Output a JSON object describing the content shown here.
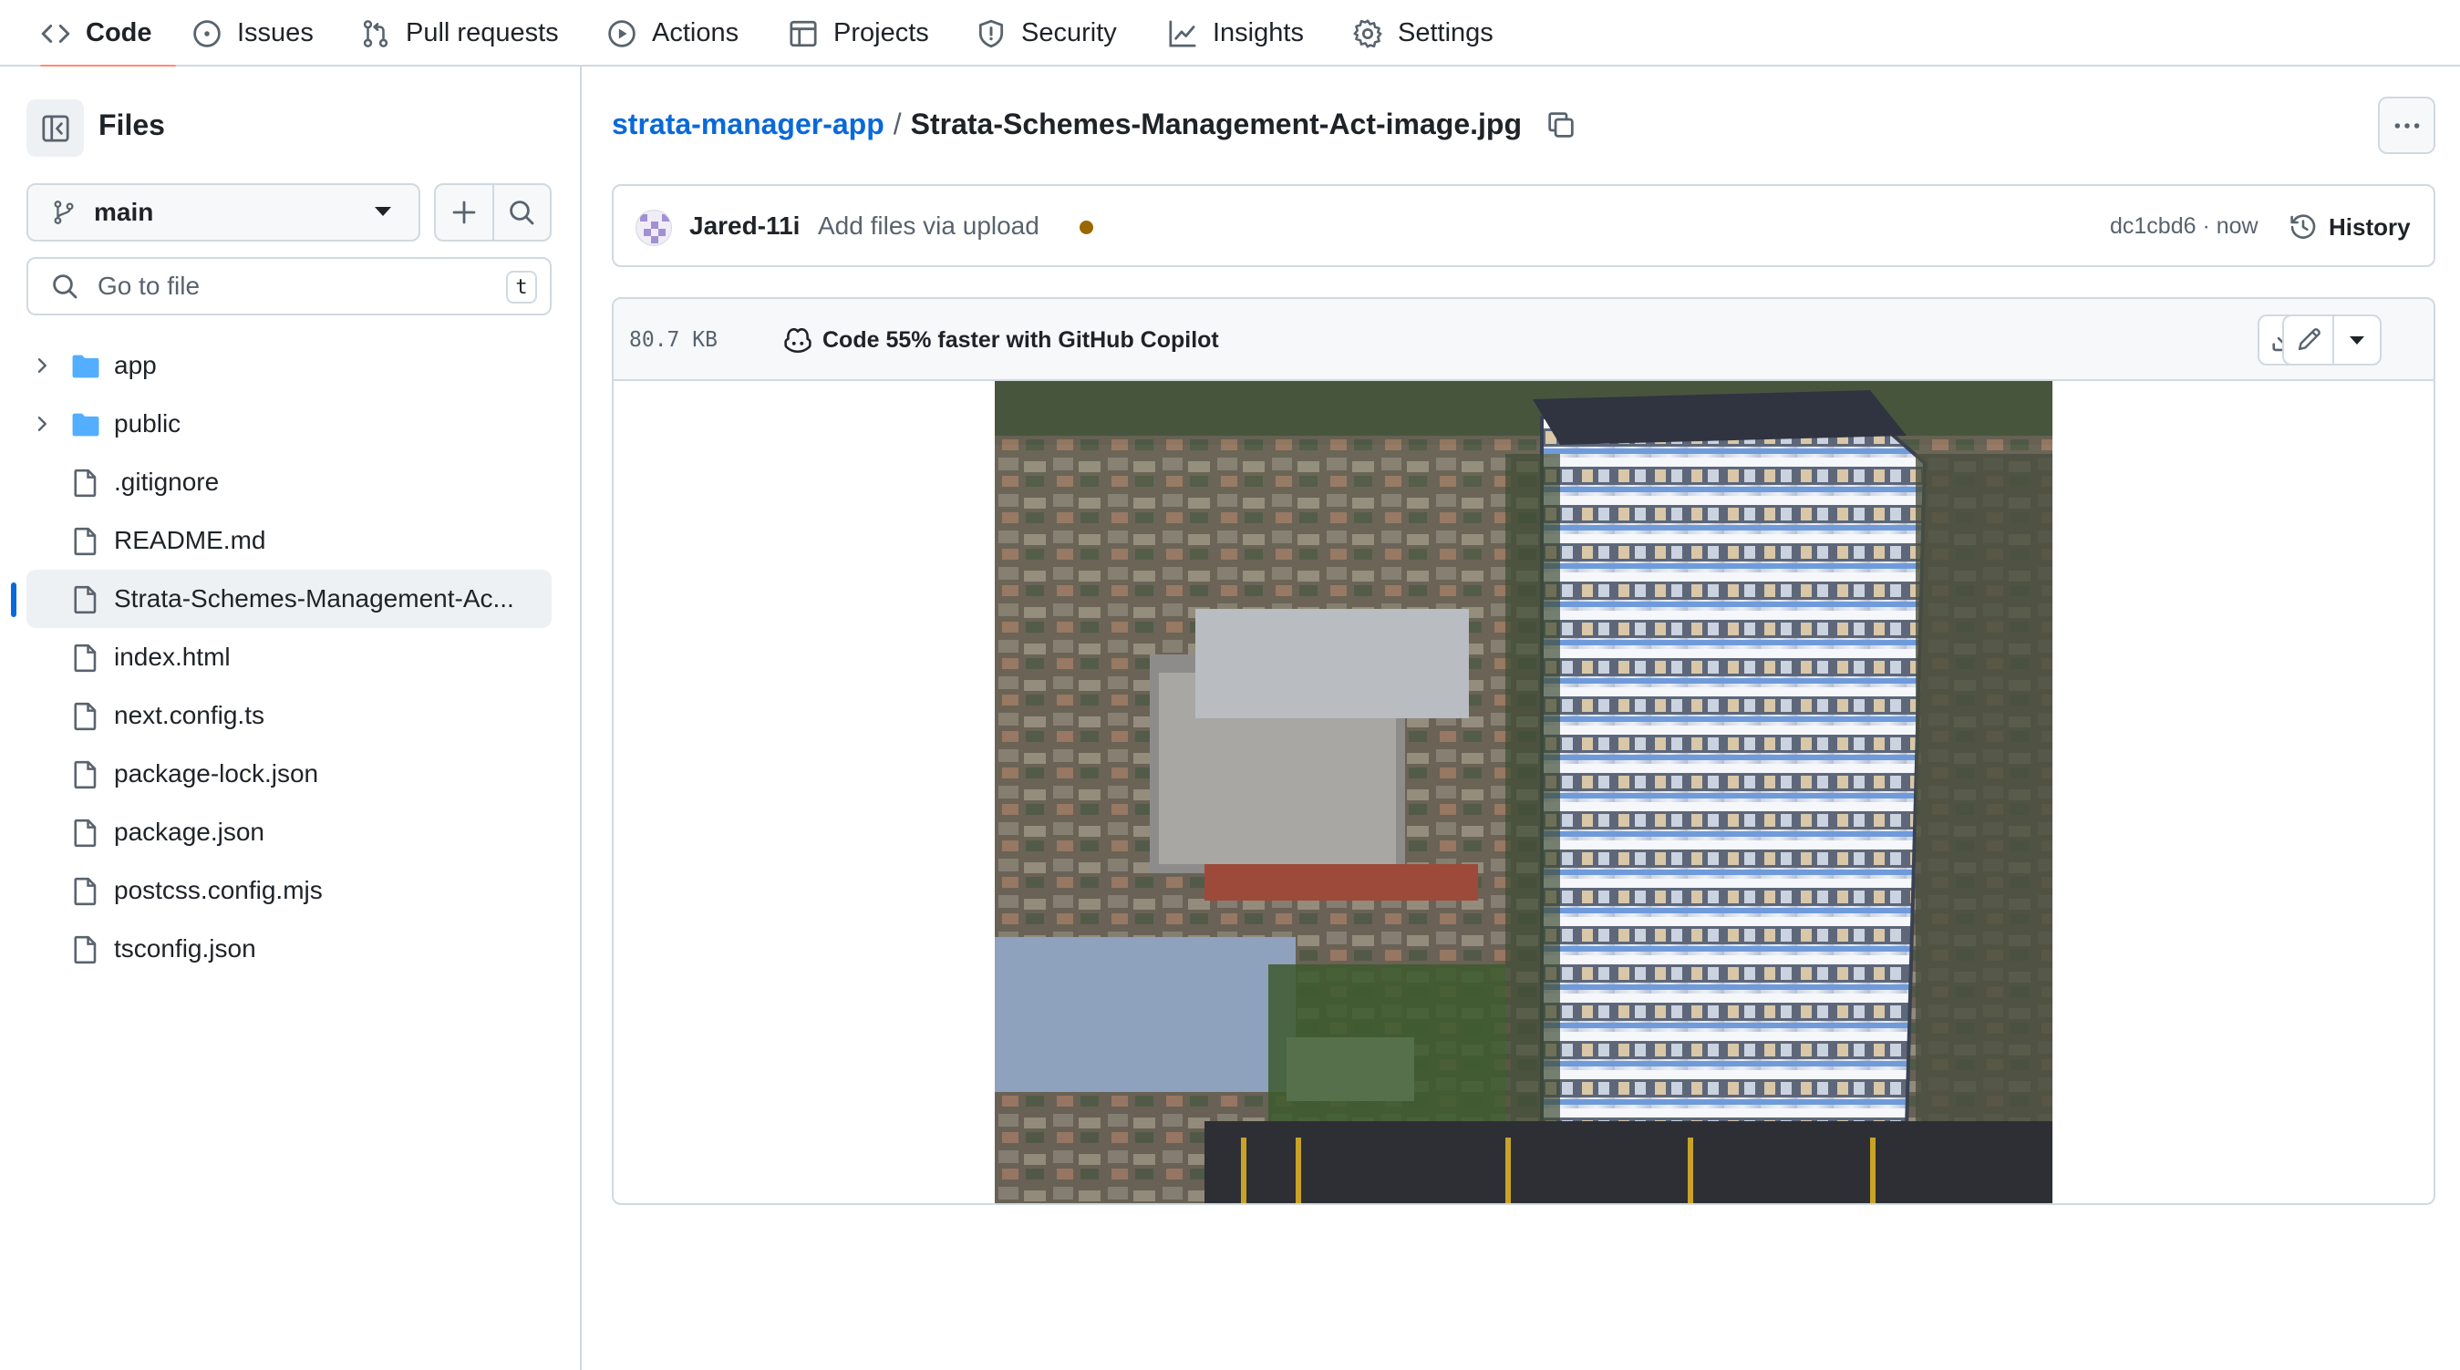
{
  "nav": {
    "tabs": [
      {
        "label": "Code",
        "icon": "code-icon",
        "active": true
      },
      {
        "label": "Issues",
        "icon": "issue-icon"
      },
      {
        "label": "Pull requests",
        "icon": "pull-request-icon"
      },
      {
        "label": "Actions",
        "icon": "play-icon"
      },
      {
        "label": "Projects",
        "icon": "table-icon"
      },
      {
        "label": "Security",
        "icon": "shield-icon"
      },
      {
        "label": "Insights",
        "icon": "graph-icon"
      },
      {
        "label": "Settings",
        "icon": "gear-icon"
      }
    ]
  },
  "sidebar": {
    "title": "Files",
    "branch": "main",
    "search_placeholder": "Go to file",
    "search_shortcut": "t",
    "items": [
      {
        "type": "folder",
        "name": "app"
      },
      {
        "type": "folder",
        "name": "public"
      },
      {
        "type": "file",
        "name": ".gitignore"
      },
      {
        "type": "file",
        "name": "README.md"
      },
      {
        "type": "file",
        "name": "Strata-Schemes-Management-Ac...",
        "selected": true
      },
      {
        "type": "file",
        "name": "index.html"
      },
      {
        "type": "file",
        "name": "next.config.ts"
      },
      {
        "type": "file",
        "name": "package-lock.json"
      },
      {
        "type": "file",
        "name": "package.json"
      },
      {
        "type": "file",
        "name": "postcss.config.mjs"
      },
      {
        "type": "file",
        "name": "tsconfig.json"
      }
    ]
  },
  "breadcrumb": {
    "repo": "strata-manager-app",
    "separator": "/",
    "file": "Strata-Schemes-Management-Act-image.jpg"
  },
  "commit": {
    "author": "Jared-11i",
    "message": "Add files via upload",
    "status_color": "#9a6700",
    "sha_time": "dc1cbd6 · now",
    "history_label": "History"
  },
  "file": {
    "size": "80.7 KB",
    "copilot_text": "Code 55% faster with GitHub Copilot"
  },
  "colors": {
    "link": "#0969da",
    "border": "#d1d9e0",
    "active_tab_underline": "#fd8c73",
    "muted": "#59636e"
  }
}
